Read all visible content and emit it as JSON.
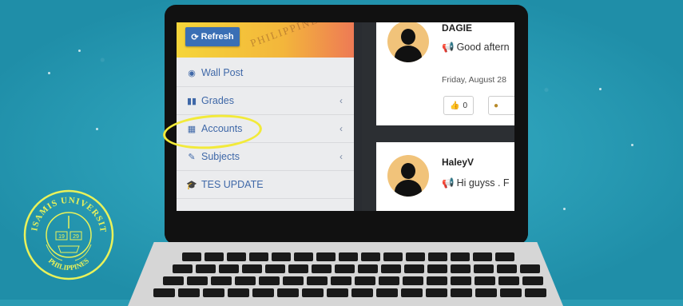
{
  "sidebar": {
    "header_arc_text": "PHILIPPINES",
    "refresh_label": "Refresh",
    "items": [
      {
        "icon": "dashboard-icon",
        "label": "Wall Post",
        "has_chevron": false
      },
      {
        "icon": "bar-chart-icon",
        "label": "Grades",
        "has_chevron": true
      },
      {
        "icon": "table-icon",
        "label": "Accounts",
        "has_chevron": true
      },
      {
        "icon": "edit-icon",
        "label": "Subjects",
        "has_chevron": true
      },
      {
        "icon": "graduation-cap-icon",
        "label": "TES UPDATE",
        "has_chevron": false
      }
    ]
  },
  "feed": {
    "posts": [
      {
        "username": "DAGIE",
        "text": "Good aftern",
        "date": "Friday, August 28",
        "likes": "0"
      },
      {
        "username": "HaleyV",
        "text": "Hi guyss . F"
      }
    ]
  },
  "seal": {
    "top_text": "MISAMIS UNIVERSITY",
    "bottom_text": "PHILIPPINES",
    "year_left": "19",
    "year_right": "29"
  },
  "colors": {
    "background": "#2a9bb3",
    "accent": "#3a6fb5",
    "highlight": "#f2ea3a"
  }
}
